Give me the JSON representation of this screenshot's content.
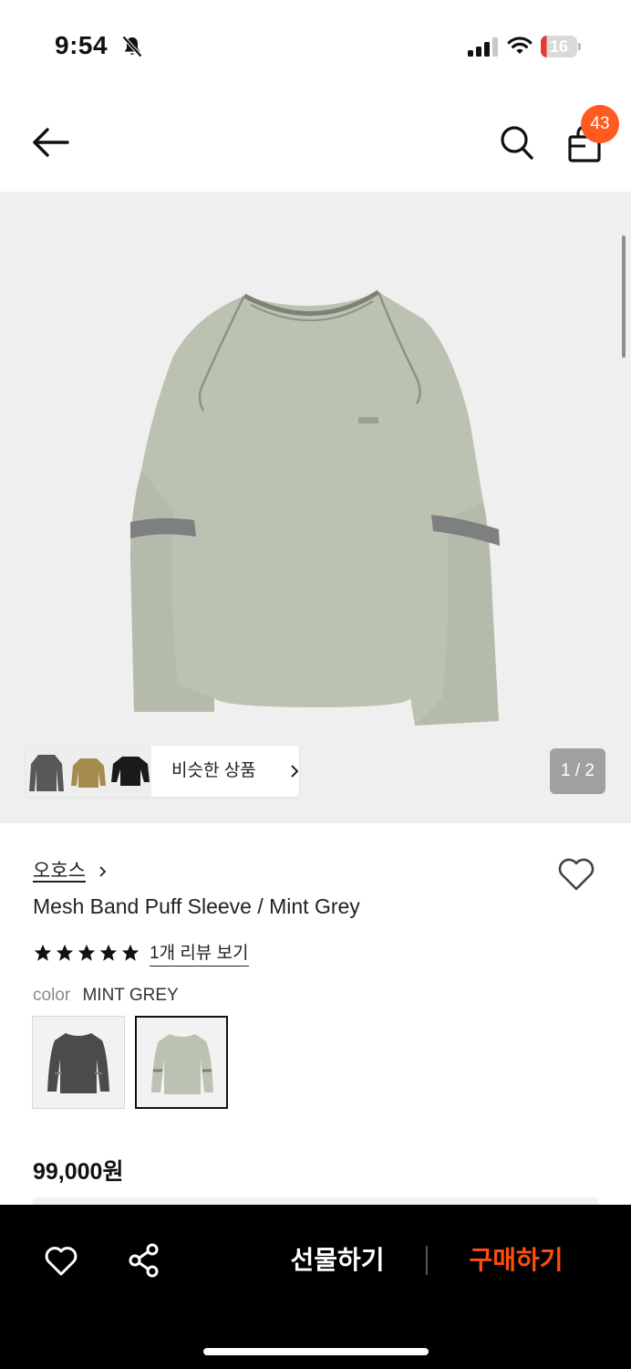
{
  "status_bar": {
    "time": "9:54",
    "battery": "16",
    "battery_level": 0.16,
    "icons": [
      "bell-slash-icon",
      "signal-icon",
      "wifi-icon",
      "battery-icon"
    ]
  },
  "nav": {
    "icons": [
      "back-arrow-icon",
      "search-icon",
      "shopping-bag-icon"
    ],
    "cart_count": "43"
  },
  "gallery": {
    "similar_label": "비슷한 상품",
    "page_indicator": "1 / 2"
  },
  "product": {
    "brand": "오호스",
    "name": "Mesh Band Puff Sleeve / Mint Grey",
    "rating_stars": 5,
    "review_link": "1개 리뷰 보기",
    "color_label": "color",
    "color_value": "MINT GREY",
    "price": "99,000원",
    "swatches": [
      "charcoal",
      "mint-grey"
    ]
  },
  "bottom_bar": {
    "gift_label": "선물하기",
    "buy_label": "구매하기"
  },
  "colors": {
    "accent": "#ff4d12",
    "badge": "#ff5a1f",
    "shirt": "#bcc2b1",
    "band": "#7e7f80"
  }
}
